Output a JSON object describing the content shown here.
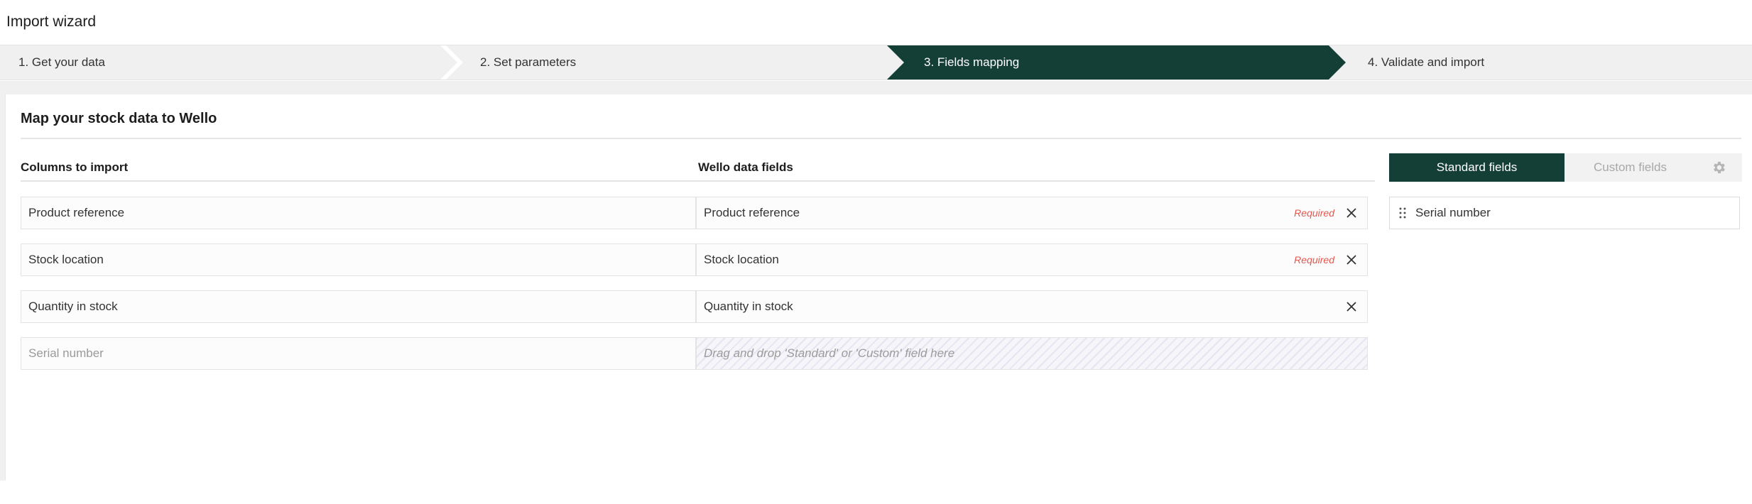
{
  "app": {
    "title": "Import wizard"
  },
  "steps": [
    {
      "label": "1. Get your data"
    },
    {
      "label": "2. Set parameters"
    },
    {
      "label": "3. Fields mapping"
    },
    {
      "label": "4. Validate and import"
    }
  ],
  "active_step": 3,
  "section": {
    "title": "Map your stock data to Wello"
  },
  "columns": {
    "source_header": "Columns to import",
    "target_header": "Wello data fields"
  },
  "mappings": [
    {
      "source": "Product reference",
      "target": "Product reference",
      "required": "Required",
      "removable": true
    },
    {
      "source": "Stock location",
      "target": "Stock location",
      "required": "Required",
      "removable": true
    },
    {
      "source": "Quantity in stock",
      "target": "Quantity in stock",
      "required": "",
      "removable": true
    },
    {
      "source": "Serial number",
      "target_placeholder": "Drag and drop 'Standard' or 'Custom' field here"
    }
  ],
  "field_panel": {
    "tabs": [
      {
        "label": "Standard fields",
        "selected": true
      },
      {
        "label": "Custom fields",
        "selected": false
      }
    ],
    "settings_icon": "gear-icon",
    "available_fields": [
      {
        "label": "Serial number",
        "icon": "drag-handle-icon"
      }
    ]
  },
  "colors": {
    "accent": "#143f37",
    "required": "#e4574f",
    "stepper_bg": "#f0f0f0"
  }
}
